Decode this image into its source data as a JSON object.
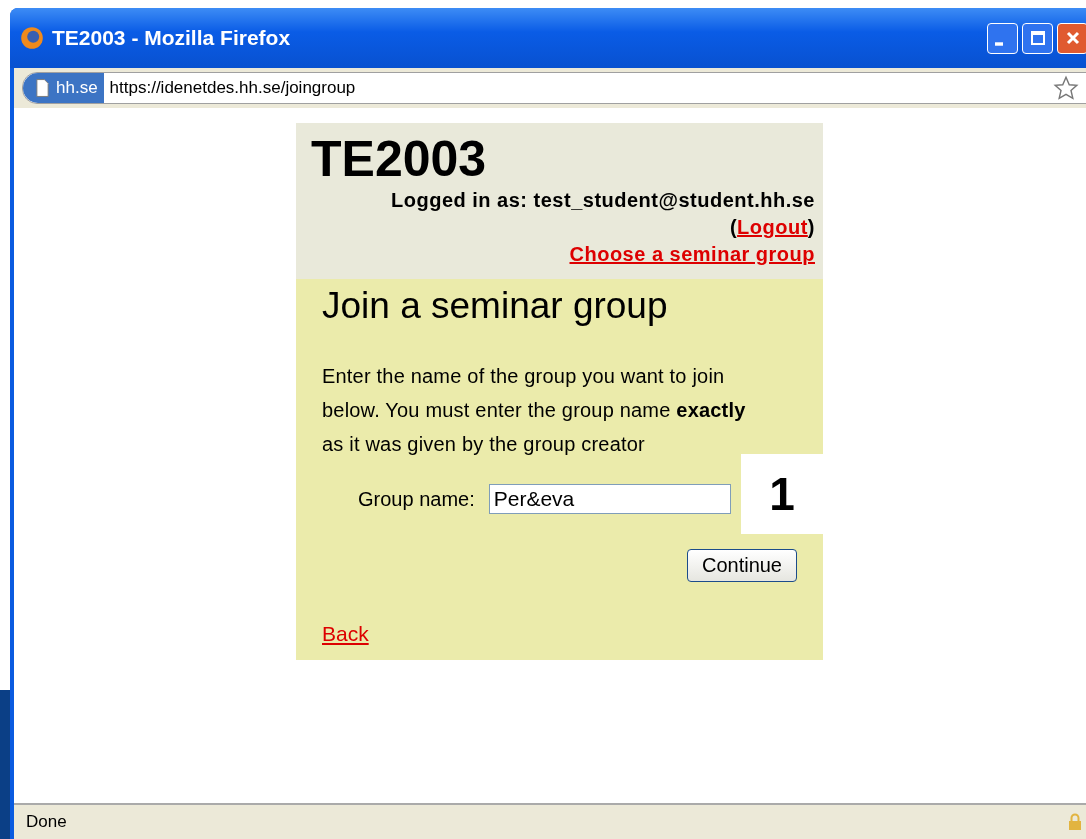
{
  "window": {
    "title": "TE2003 - Mozilla Firefox"
  },
  "address_bar": {
    "site_label": "hh.se",
    "url": "https://idenetdes.hh.se/joingroup"
  },
  "page": {
    "heading": "TE2003",
    "logged_in": "Logged in as: test_student@student.hh.se",
    "logout_prefix": "(",
    "logout_link": "Logout",
    "logout_suffix": ")",
    "choose_link": "Choose a seminar group",
    "title": "Join a seminar group",
    "instructions": "Enter the name of the group you want to join below. You must enter the group name **exactly** as it was given by the group creator",
    "field_label": "Group name:",
    "field_value": "Per&eva",
    "button": "Continue",
    "back_link": "Back"
  },
  "callout": {
    "number": "1"
  },
  "status_bar": {
    "text": "Done"
  }
}
